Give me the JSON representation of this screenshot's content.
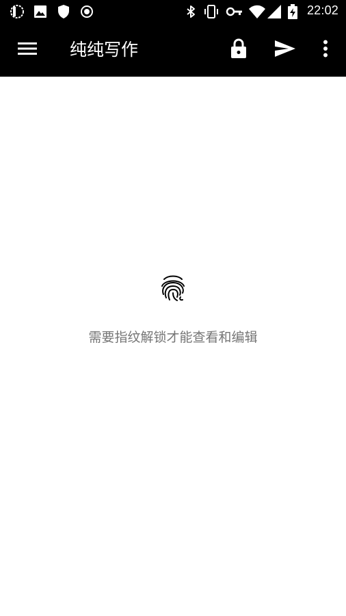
{
  "status_bar": {
    "time": "22:02",
    "left_icons": [
      "app-notification-icon",
      "image-icon",
      "shield-icon",
      "record-icon"
    ],
    "right_icons": [
      "bluetooth-icon",
      "vibrate-icon",
      "vpn-key-icon",
      "wifi-icon",
      "cell-signal-icon",
      "battery-charging-icon"
    ]
  },
  "toolbar": {
    "title": "纯纯写作",
    "actions": [
      "menu-icon",
      "lock-icon",
      "send-icon",
      "more-vert-icon"
    ]
  },
  "content": {
    "message": "需要指纹解锁才能查看和编辑",
    "icon": "fingerprint-icon"
  },
  "colors": {
    "bar_background": "#000000",
    "content_background": "#ffffff",
    "message_text": "#757575"
  }
}
